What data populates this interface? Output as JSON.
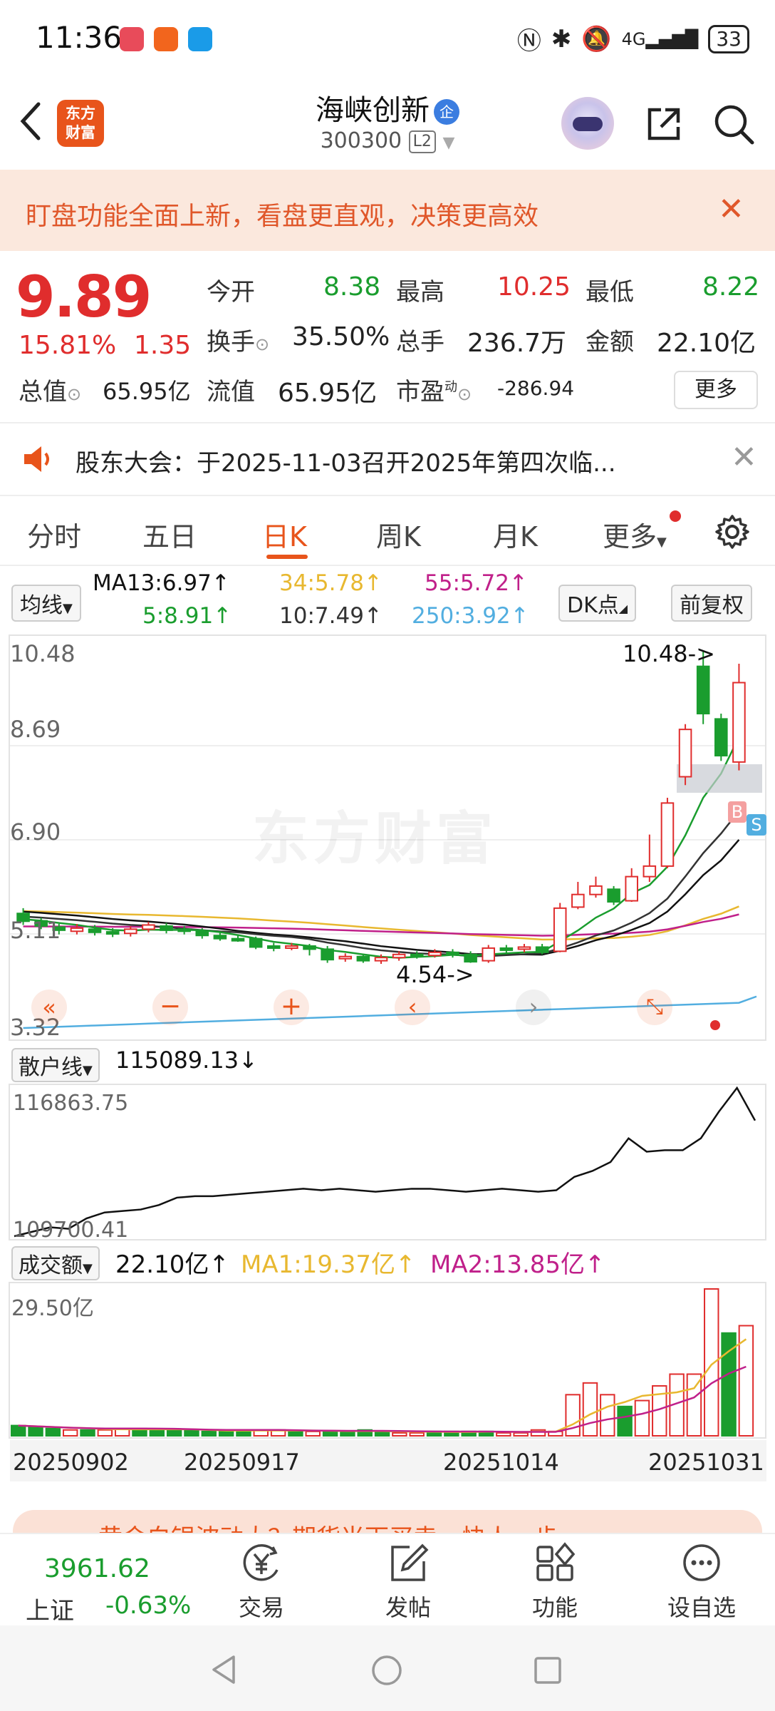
{
  "status": {
    "time": "11:36",
    "battery": "33",
    "net": "4G"
  },
  "header": {
    "logo": "东方\n财富",
    "stock_name": "海峡创新",
    "qiye_badge": "企",
    "stock_code": "300300",
    "level": "L2"
  },
  "banner": {
    "text": "盯盘功能全面上新，看盘更直观，决策更高效",
    "close": "✕"
  },
  "quote": {
    "price": "9.89",
    "change_pct": "15.81%",
    "change_amt": "1.35",
    "open_label": "今开",
    "open": "8.38",
    "high_label": "最高",
    "high": "10.25",
    "low_label": "最低",
    "low": "8.22",
    "turnover_label": "换手",
    "turnover": "35.50%",
    "volume_label": "总手",
    "volume": "236.7万",
    "amount_label": "金额",
    "amount": "22.10亿",
    "mktcap_label": "总值",
    "mktcap": "65.95亿",
    "float_label": "流值",
    "float": "65.95亿",
    "pe_label": "市盈",
    "pe_sup": "动",
    "pe": "-286.94",
    "more": "更多"
  },
  "notice": {
    "text": "股东大会：于2025-11-03召开2025年第四次临...",
    "close": "✕"
  },
  "tabs": [
    "分时",
    "五日",
    "日K",
    "周K",
    "月K",
    "更多"
  ],
  "active_tab": "日K",
  "indicators": {
    "selector": "均线",
    "ma13": "MA13:6.97↑",
    "ma34": "34:5.78↑",
    "ma55": "55:5.72↑",
    "ma5": "5:8.91↑",
    "ma10": "10:7.49↑",
    "ma250": "250:3.92↑",
    "dk": "DK点",
    "fq": "前复权"
  },
  "kchart": {
    "y_labels": [
      "10.48",
      "8.69",
      "6.90",
      "5.11",
      "3.32"
    ],
    "hi_label": "10.48->",
    "lo_label": "4.54->",
    "watermark": "东方财富",
    "b_marker": "B",
    "s_marker": "S"
  },
  "sanhu": {
    "selector": "散户线",
    "value": "115089.13↓",
    "y_top": "116863.75",
    "y_bottom": "109700.41"
  },
  "vol": {
    "selector": "成交额",
    "value": "22.10亿↑",
    "ma1": "MA1:19.37亿↑",
    "ma2": "MA2:13.85亿↑",
    "y_top": "29.50亿"
  },
  "dates": [
    "20250902",
    "20250917",
    "20251014",
    "20251031"
  ],
  "ticker": {
    "text": "黄金白银波动大？期货当下买卖，快人一步"
  },
  "bottom": {
    "index_value": "3961.62",
    "index_name": "上证",
    "index_chg": "-0.63%",
    "nav": [
      "交易",
      "发帖",
      "功能",
      "设自选"
    ]
  },
  "colors": {
    "up": "#e02d2d",
    "down": "#1a9d2e",
    "accent": "#e8541b",
    "ma5": "#1a9d2e",
    "ma10": "#333333",
    "ma13": "#111111",
    "ma34": "#e8b830",
    "ma55": "#c0208a",
    "ma250": "#52aee0"
  }
}
